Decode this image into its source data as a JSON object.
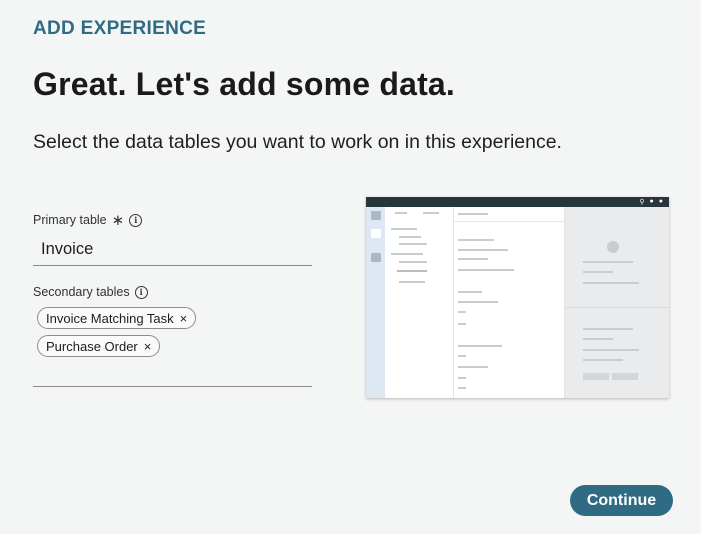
{
  "header": {
    "eyebrow": "ADD EXPERIENCE",
    "title": "Great. Let's add some data.",
    "subtitle": "Select the data tables you want to work on in this experience."
  },
  "primary_table": {
    "label": "Primary table",
    "required_marker": "∗",
    "info_icon": "info-icon",
    "value": "Invoice"
  },
  "secondary_tables": {
    "label": "Secondary tables",
    "info_icon": "info-icon",
    "chips": [
      {
        "label": "Invoice Matching Task",
        "remove": "×"
      },
      {
        "label": "Purchase Order",
        "remove": "×"
      }
    ]
  },
  "preview": {
    "icons": [
      "search-icon",
      "bell-icon",
      "user-icon"
    ],
    "colors": {
      "topbar": "#26363c",
      "rail": "#dde8f3",
      "accent": "#2f6c84"
    }
  },
  "footer": {
    "continue_label": "Continue"
  }
}
